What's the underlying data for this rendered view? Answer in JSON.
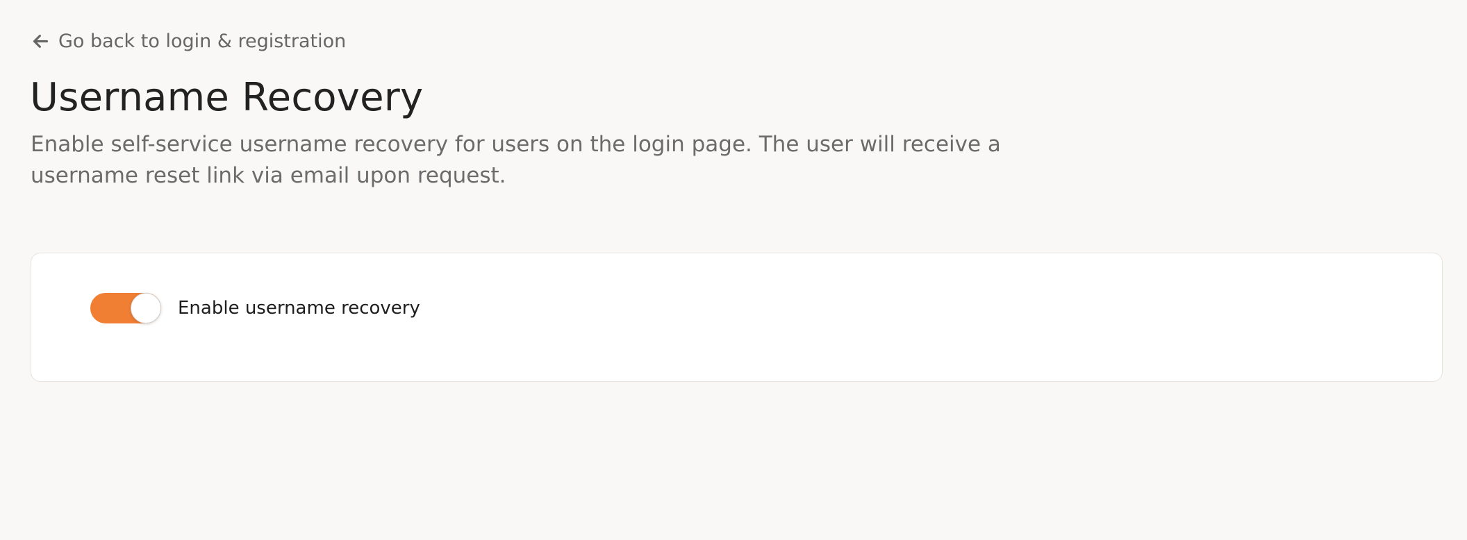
{
  "nav": {
    "back_icon": "arrow-left-icon",
    "back_label": "Go back to login & registration"
  },
  "header": {
    "title": "Username Recovery",
    "description": "Enable self-service username recovery for users on the login page. The user will receive a username reset link via email upon request."
  },
  "settings": {
    "toggle_label": "Enable username recovery",
    "toggle_enabled": true,
    "accent_color": "#f07f34"
  }
}
